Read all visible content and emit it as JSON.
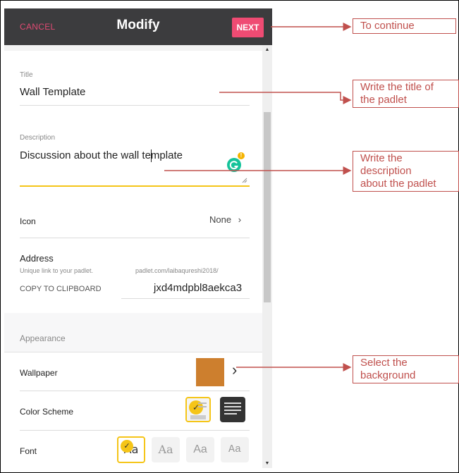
{
  "header": {
    "cancel_label": "CANCEL",
    "title": "Modify",
    "next_label": "NEXT"
  },
  "form": {
    "title_label": "Title",
    "title_value": "Wall Template",
    "description_label": "Description",
    "description_value": "Discussion about the wall template",
    "icon_label": "Icon",
    "icon_value": "None",
    "address_label": "Address",
    "address_hint": "Unique link to your padlet.",
    "address_prefix": "padlet.com/laibaqureshi2018/",
    "copy_label": "COPY TO CLIPBOARD",
    "address_slug": "jxd4mdpbl8aekca3"
  },
  "appearance": {
    "section_label": "Appearance",
    "wallpaper_label": "Wallpaper",
    "wallpaper_color": "#cd7f2e",
    "color_scheme_label": "Color Scheme",
    "font_label": "Font",
    "font_samples": [
      "Aa",
      "Aa",
      "Aa",
      "Aa"
    ]
  },
  "annotations": {
    "continue": "To continue",
    "title_hint_1": "Write the title of",
    "title_hint_2": "the padlet",
    "desc_hint_1": "Write the",
    "desc_hint_2": "description",
    "desc_hint_3": "about the padlet",
    "bg_hint_1": "Select the",
    "bg_hint_2": "background"
  },
  "colors": {
    "accent": "#ef4b73",
    "highlight": "#f5c518",
    "annotation": "#c0504d"
  }
}
